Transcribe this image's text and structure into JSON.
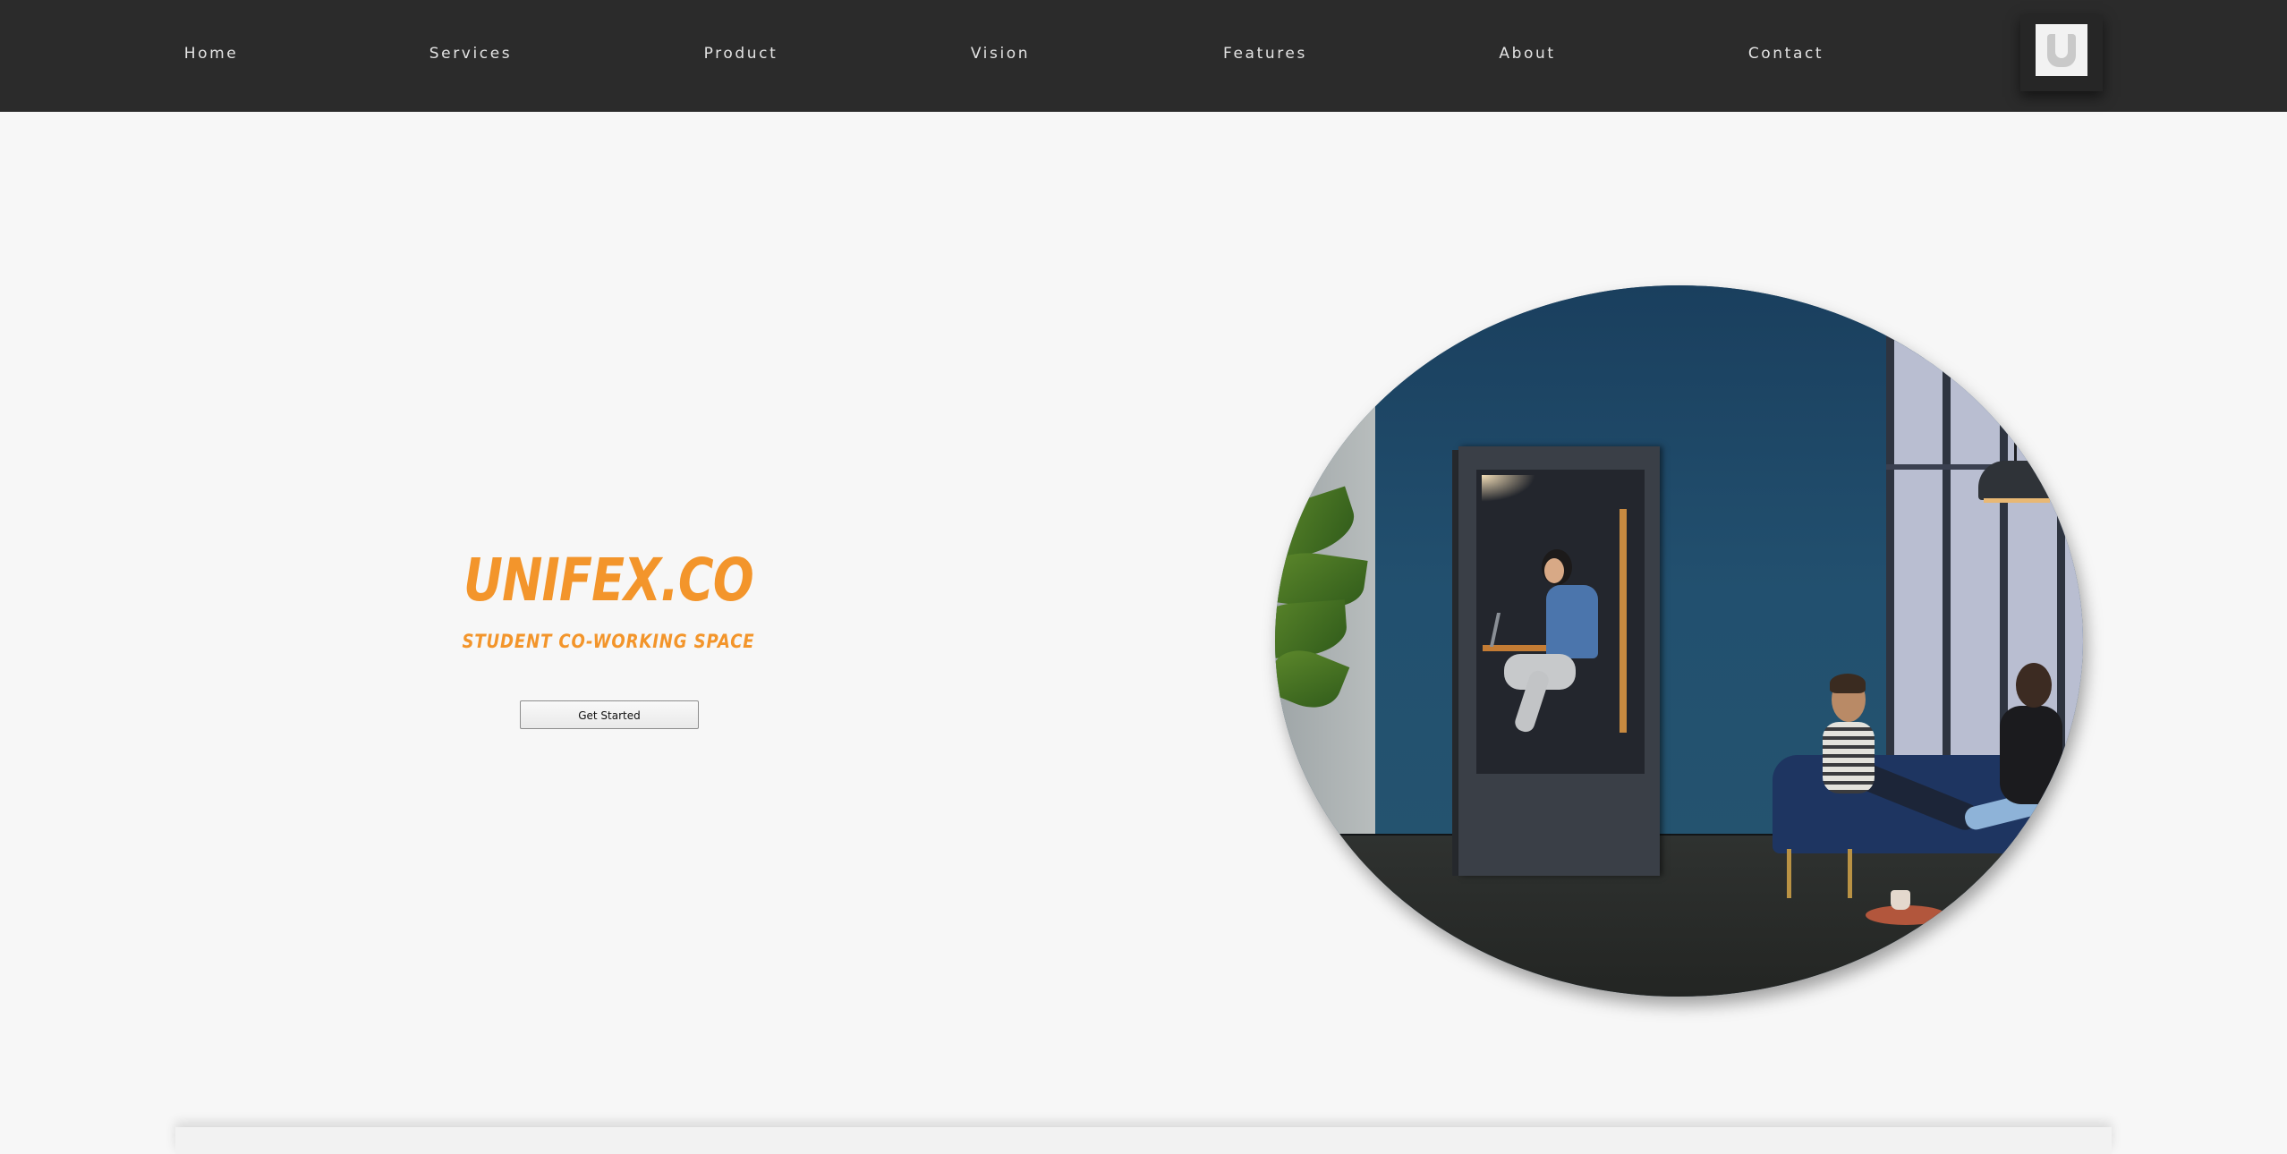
{
  "nav": {
    "items": [
      {
        "label": "Home"
      },
      {
        "label": "Services"
      },
      {
        "label": "Product"
      },
      {
        "label": "Vision"
      },
      {
        "label": "Features"
      },
      {
        "label": "About"
      },
      {
        "label": "Contact"
      }
    ],
    "logo_icon": "u-logo-icon"
  },
  "hero": {
    "title": "UNIFEX.CO",
    "subtitle": "STUDENT CO-WORKING SPACE",
    "cta_label": "Get Started",
    "image_icon": "office-booth-photo"
  },
  "colors": {
    "nav_background": "#2b2b2b",
    "page_background": "#f7f7f7",
    "brand_accent": "#f3952b"
  }
}
